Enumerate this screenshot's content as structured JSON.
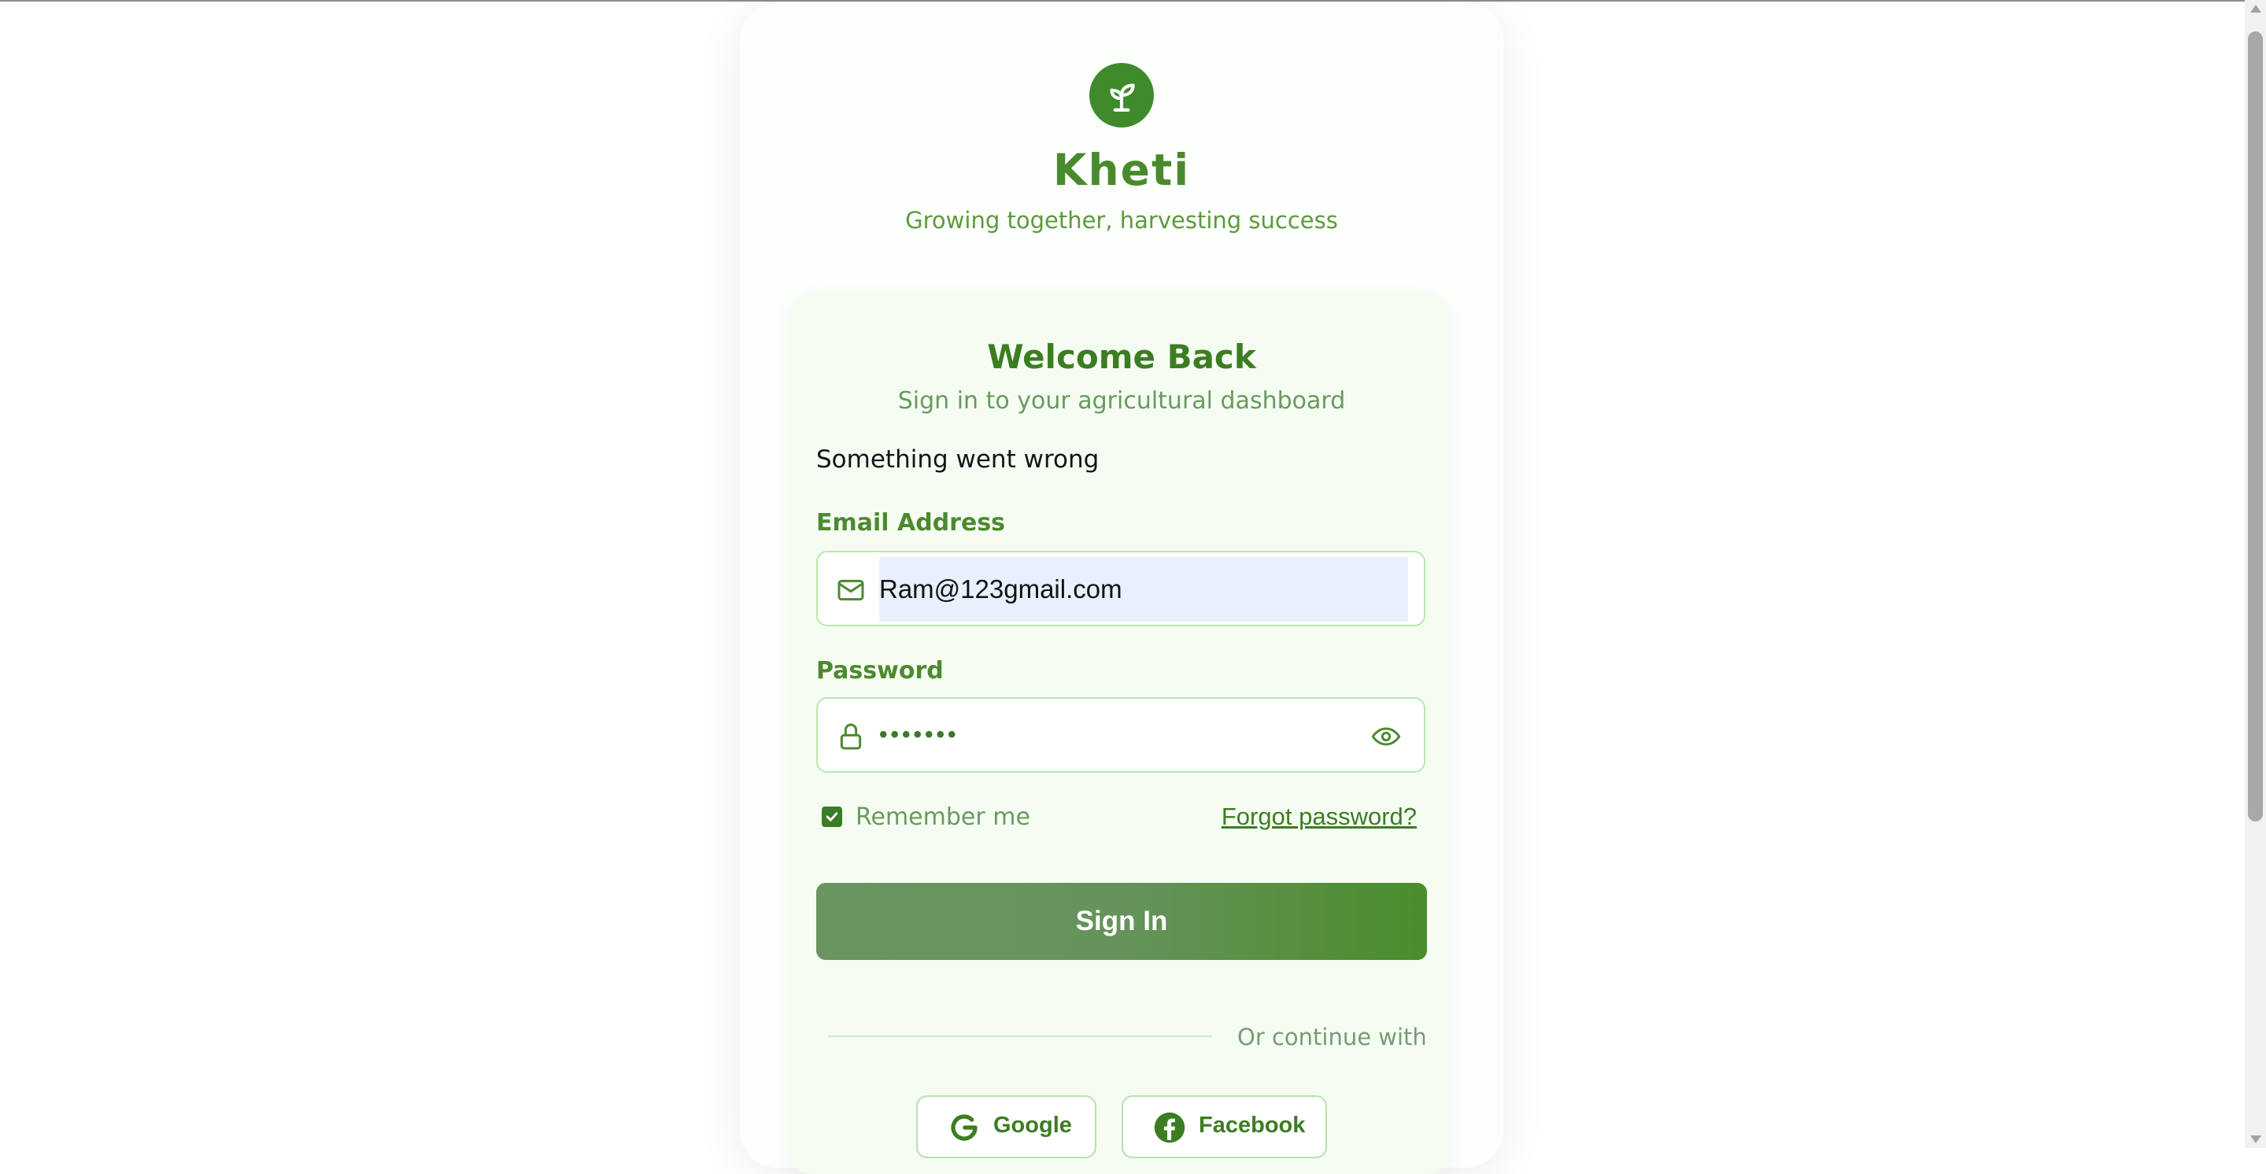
{
  "brand": {
    "name": "Kheti",
    "tagline": "Growing together, harvesting success",
    "logo_icon": "seedling-icon",
    "color": "#3f8a2b"
  },
  "login": {
    "title": "Welcome Back",
    "subtitle": "Sign in to your agricultural dashboard",
    "error_message": "Something went wrong",
    "email": {
      "label": "Email Address",
      "value": "Ram@123gmail.com",
      "icon": "mail-icon"
    },
    "password": {
      "label": "Password",
      "masked_value": "•••••••",
      "icon": "lock-icon",
      "toggle_icon": "eye-icon"
    },
    "remember_me": {
      "label": "Remember me",
      "checked": true
    },
    "forgot_password_label": "Forgot password?",
    "submit_label": "Sign In",
    "divider_text": "Or continue with",
    "social": [
      {
        "label": "Google",
        "icon": "google-icon"
      },
      {
        "label": "Facebook",
        "icon": "facebook-icon"
      }
    ]
  },
  "colors": {
    "primary": "#4a8d2b",
    "button_gradient_start": "#6a9560",
    "autofill_bg": "#e8f0fe"
  }
}
